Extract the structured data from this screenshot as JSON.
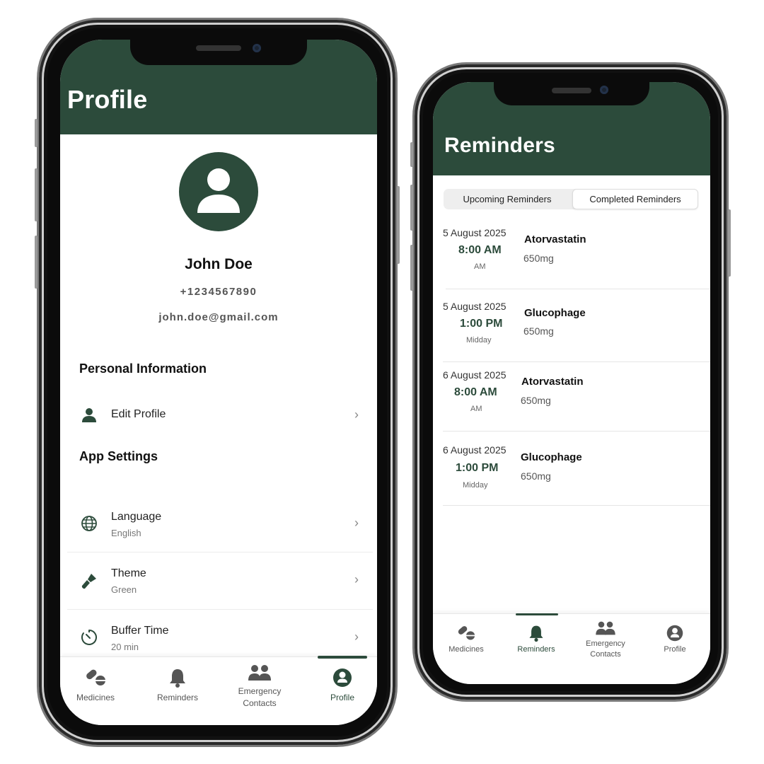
{
  "profile_screen": {
    "title": "Profile",
    "user": {
      "name": "John Doe",
      "phone": "+1234567890",
      "email": "john.doe@gmail.com"
    },
    "personal_section": {
      "title": "Personal Information",
      "edit_profile": "Edit Profile"
    },
    "settings_section": {
      "title": "App Settings",
      "items": [
        {
          "label": "Language",
          "value": "English",
          "icon": "globe-icon"
        },
        {
          "label": "Theme",
          "value": "Green",
          "icon": "paint-brush-icon"
        },
        {
          "label": "Buffer Time",
          "value": "20 min",
          "icon": "timer-icon"
        }
      ]
    },
    "nav": {
      "active": "Profile",
      "items": [
        {
          "label": "Medicines",
          "icon": "pills-icon"
        },
        {
          "label": "Reminders",
          "icon": "bell-icon"
        },
        {
          "label_line1": "Emergency",
          "label_line2": "Contacts",
          "icon": "group-icon"
        },
        {
          "label": "Profile",
          "icon": "user-circle-icon"
        }
      ]
    }
  },
  "reminders_screen": {
    "title": "Reminders",
    "tabs": {
      "upcoming": "Upcoming Reminders",
      "completed": "Completed Reminders",
      "selected": "Completed Reminders"
    },
    "items": [
      {
        "date": "5 August 2025",
        "time": "8:00 AM",
        "period": "AM",
        "medicine": "Atorvastatin",
        "dose": "650mg"
      },
      {
        "date": "5 August 2025",
        "time": "1:00 PM",
        "period": "Midday",
        "medicine": "Glucophage",
        "dose": "650mg"
      },
      {
        "date": "6 August 2025",
        "time": "8:00 AM",
        "period": "AM",
        "medicine": "Atorvastatin",
        "dose": "650mg"
      },
      {
        "date": "6 August 2025",
        "time": "1:00 PM",
        "period": "Midday",
        "medicine": "Glucophage",
        "dose": "650mg"
      }
    ],
    "nav": {
      "active": "Reminders",
      "items": [
        {
          "label": "Medicines",
          "icon": "pills-icon"
        },
        {
          "label": "Reminders",
          "icon": "bell-icon"
        },
        {
          "label_line1": "Emergency",
          "label_line2": "Contacts",
          "icon": "group-icon"
        },
        {
          "label": "Profile",
          "icon": "user-circle-icon"
        }
      ]
    }
  },
  "colors": {
    "brand": "#2c4b3b",
    "background": "#ffffff"
  }
}
